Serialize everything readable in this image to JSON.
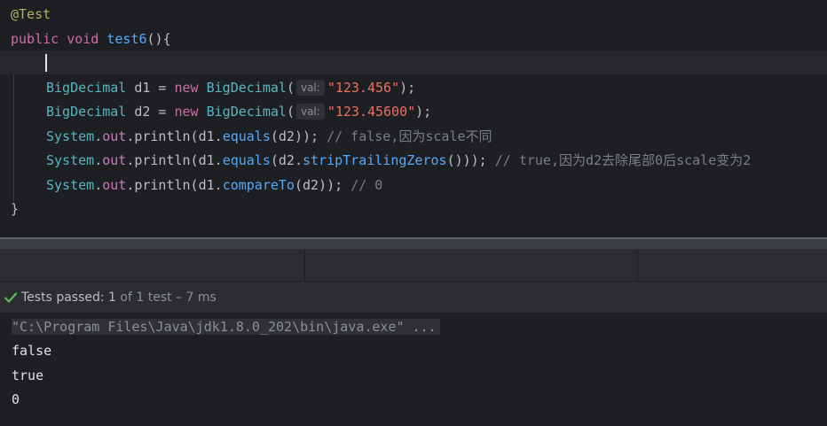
{
  "editor": {
    "annotation": "@Test",
    "signature": {
      "keyword1": "public",
      "keyword2": "void",
      "method": "test6",
      "rest": "(){"
    },
    "line_d1": {
      "type": "BigDecimal",
      "var": " d1 = ",
      "kw_new": "new",
      "ctor": "BigDecimal",
      "paren": "(",
      "hint": "val:",
      "value": "\"123.456\"",
      "end": ");"
    },
    "line_d2": {
      "type": "BigDecimal",
      "var": " d2 = ",
      "kw_new": "new",
      "ctor": "BigDecimal",
      "paren": "(",
      "hint": "val:",
      "value": "\"123.45600\"",
      "end": ");"
    },
    "println1": {
      "cls": "System",
      "dot1": ".",
      "field": "out",
      "dot2": ".println(d1.",
      "method": "equals",
      "args": "(d2)); ",
      "comment": "// false,因为scale不同"
    },
    "println2": {
      "cls": "System",
      "dot1": ".",
      "field": "out",
      "dot2": ".println(d1.",
      "method": "equals",
      "mid": "(d2.",
      "method2": "stripTrailingZeros",
      "args": "())); ",
      "comment": "// true,因为d2去除尾部0后scale变为2"
    },
    "println3": {
      "cls": "System",
      "dot1": ".",
      "field": "out",
      "dot2": ".println(d1.",
      "method": "compareTo",
      "args": "(d2)); ",
      "comment": "// 0"
    },
    "closing": "}"
  },
  "status": {
    "label": "Tests passed: ",
    "count": "1",
    "detail": " of 1 test – 7 ms",
    "icon": "check-icon",
    "icon_color": "#5fb865"
  },
  "console": {
    "command": "\"C:\\Program Files\\Java\\jdk1.8.0_202\\bin\\java.exe\" ...",
    "output": [
      "false",
      "true",
      "0"
    ]
  }
}
